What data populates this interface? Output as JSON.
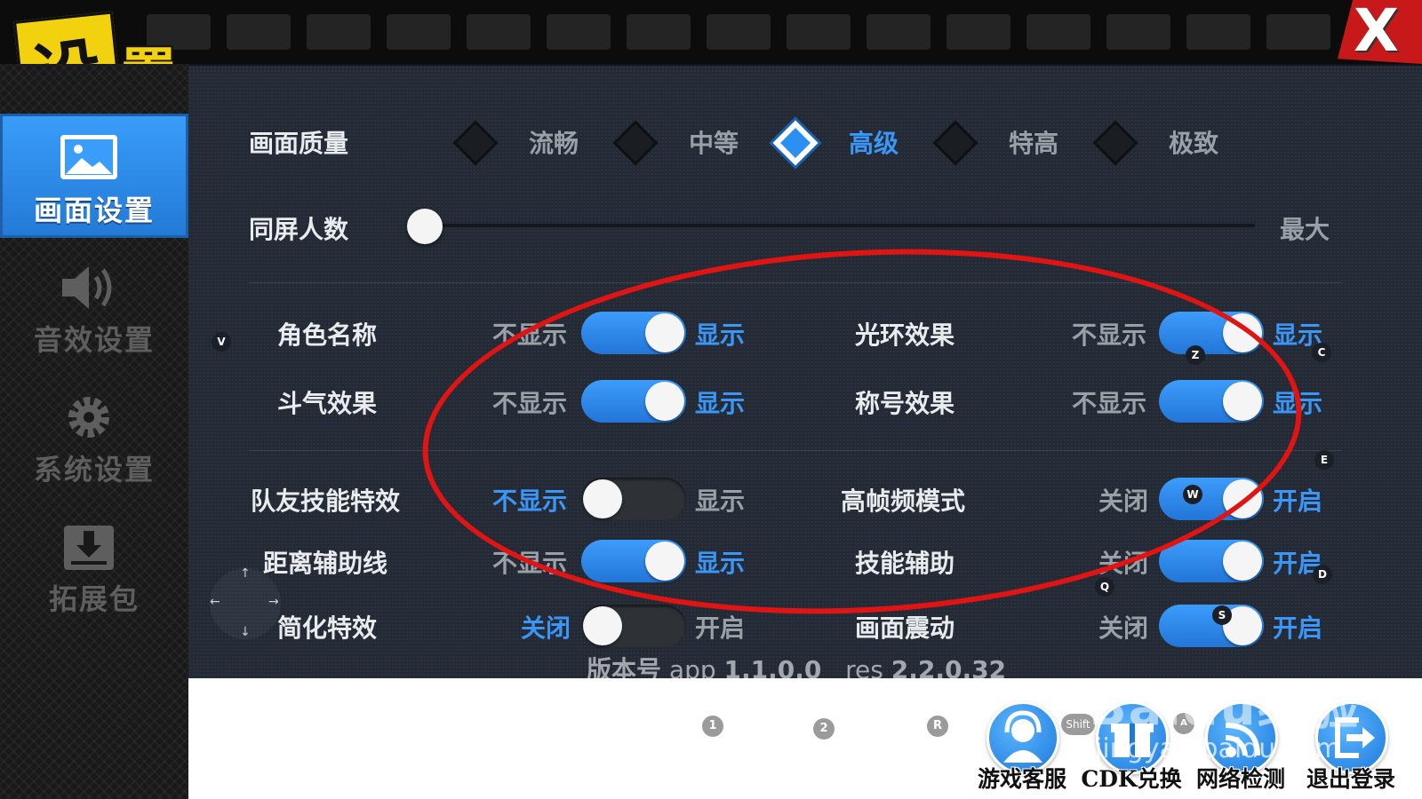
{
  "title": {
    "char1": "设",
    "char2": "置"
  },
  "close": {
    "label": "X"
  },
  "sidebar": {
    "items": [
      {
        "label": "画面设置",
        "active": true,
        "icon": "image-icon"
      },
      {
        "label": "音效设置",
        "active": false,
        "icon": "speaker-icon"
      },
      {
        "label": "系统设置",
        "active": false,
        "icon": "gear-icon"
      },
      {
        "label": "拓展包",
        "active": false,
        "icon": "download-icon"
      }
    ]
  },
  "quality": {
    "label": "画面质量",
    "options": [
      "流畅",
      "中等",
      "高级",
      "特高",
      "极致"
    ],
    "selected": "高级"
  },
  "players": {
    "label": "同屏人数",
    "max_label": "最大",
    "value": 0
  },
  "toggles": [
    {
      "label": "角色名称",
      "off_text": "不显示",
      "on_text": "显示",
      "on": true
    },
    {
      "label": "光环效果",
      "off_text": "不显示",
      "on_text": "显示",
      "on": true
    },
    {
      "label": "斗气效果",
      "off_text": "不显示",
      "on_text": "显示",
      "on": true
    },
    {
      "label": "称号效果",
      "off_text": "不显示",
      "on_text": "显示",
      "on": true
    },
    {
      "label": "队友技能特效",
      "off_text": "不显示",
      "on_text": "显示",
      "on": false
    },
    {
      "label": "高帧频模式",
      "off_text": "关闭",
      "on_text": "开启",
      "on": true
    },
    {
      "label": "距离辅助线",
      "off_text": "不显示",
      "on_text": "显示",
      "on": true
    },
    {
      "label": "技能辅助",
      "off_text": "关闭",
      "on_text": "开启",
      "on": true
    },
    {
      "label": "简化特效",
      "off_text": "关闭",
      "on_text": "开启",
      "on": false
    },
    {
      "label": "画面震动",
      "off_text": "关闭",
      "on_text": "开启",
      "on": true
    }
  ],
  "version": {
    "prefix": "版本号",
    "app_label": "app",
    "app_version": "1.1.0.0",
    "res_label": "res",
    "res_version": "2.2.0.32"
  },
  "bottom_buttons": [
    {
      "label": "游戏客服",
      "icon": "headset-icon"
    },
    {
      "label": "CDK兑换",
      "icon": "gift-icon"
    },
    {
      "label": "网络检测",
      "icon": "wifi-icon"
    },
    {
      "label": "退出登录",
      "icon": "logout-icon"
    }
  ],
  "hotkeys": {
    "h1": "1",
    "h2": "2",
    "r": "R",
    "shift": "Shift",
    "a": "A",
    "v": "V",
    "z": "Z",
    "c": "C",
    "e": "E",
    "w": "W",
    "q": "Q",
    "d": "D",
    "s": "S"
  },
  "dpad": {
    "up": "↑",
    "down": "↓",
    "left": "←",
    "right": "→"
  },
  "watermark": {
    "main": "Baidu经验",
    "sub": "jingyan.baidu.com"
  },
  "colors": {
    "accent": "#3b97f7",
    "annotation": "#e11414",
    "title_yellow": "#f2d10f",
    "close_red": "#c8191a"
  }
}
